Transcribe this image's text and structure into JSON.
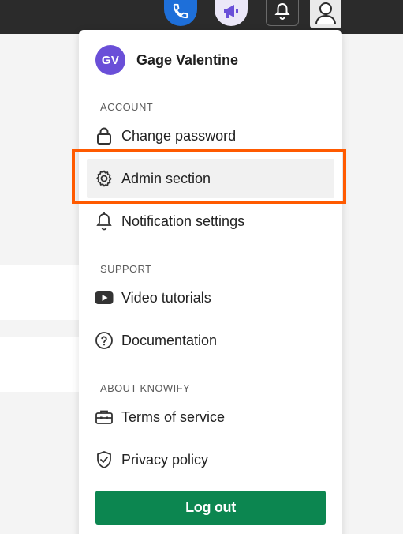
{
  "topbar": {
    "icons": [
      "phone-icon",
      "megaphone-icon",
      "bell-icon",
      "user-icon"
    ]
  },
  "profile": {
    "initials": "GV",
    "name": "Gage Valentine"
  },
  "account": {
    "heading": "ACCOUNT",
    "items": [
      {
        "label": "Change password",
        "icon": "lock-icon"
      },
      {
        "label": "Admin section",
        "icon": "gear-icon"
      },
      {
        "label": "Notification settings",
        "icon": "bell-icon"
      }
    ]
  },
  "support": {
    "heading": "SUPPORT",
    "items": [
      {
        "label": "Video tutorials",
        "icon": "youtube-icon"
      },
      {
        "label": "Documentation",
        "icon": "question-circle-icon"
      }
    ]
  },
  "about": {
    "heading": "ABOUT KNOWIFY",
    "items": [
      {
        "label": "Terms of service",
        "icon": "toolbox-icon"
      },
      {
        "label": "Privacy policy",
        "icon": "shield-check-icon"
      }
    ]
  },
  "logout_label": "Log out",
  "colors": {
    "avatar": "#6a4fd8",
    "logout": "#0c8650",
    "highlight": "#ff5a00",
    "phone_button": "#1e6fd9"
  }
}
